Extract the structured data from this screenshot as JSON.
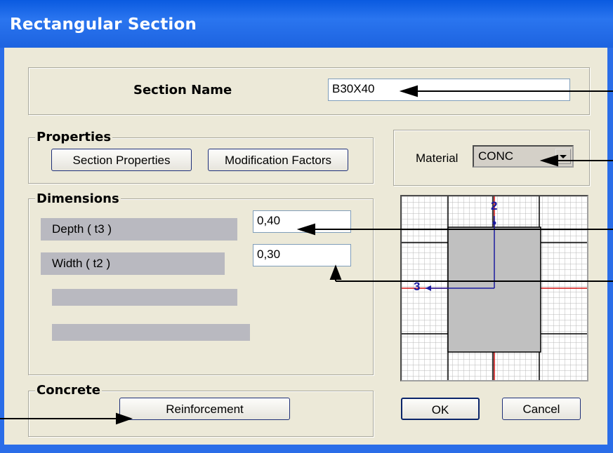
{
  "window": {
    "title": "Rectangular Section"
  },
  "section_name": {
    "label": "Section Name",
    "value": "B30X40"
  },
  "properties": {
    "title": "Properties",
    "section_properties_btn": "Section Properties",
    "modification_factors_btn": "Modification Factors"
  },
  "material": {
    "label": "Material",
    "value": "CONC"
  },
  "dimensions": {
    "title": "Dimensions",
    "depth": {
      "label": "Depth  ( t3 )",
      "value": "0,40"
    },
    "width": {
      "label": "Width  ( t2 )",
      "value": "0,30"
    }
  },
  "concrete": {
    "title": "Concrete",
    "reinforcement_btn": "Reinforcement"
  },
  "preview": {
    "axis2": "2",
    "axis3": "3"
  },
  "buttons": {
    "ok": "OK",
    "cancel": "Cancel"
  },
  "colors": {
    "titlebar": "#1d63e0",
    "dialog_bg": "#ece9d8",
    "axis": "#1a1aa0",
    "centerline": "#d01010"
  }
}
